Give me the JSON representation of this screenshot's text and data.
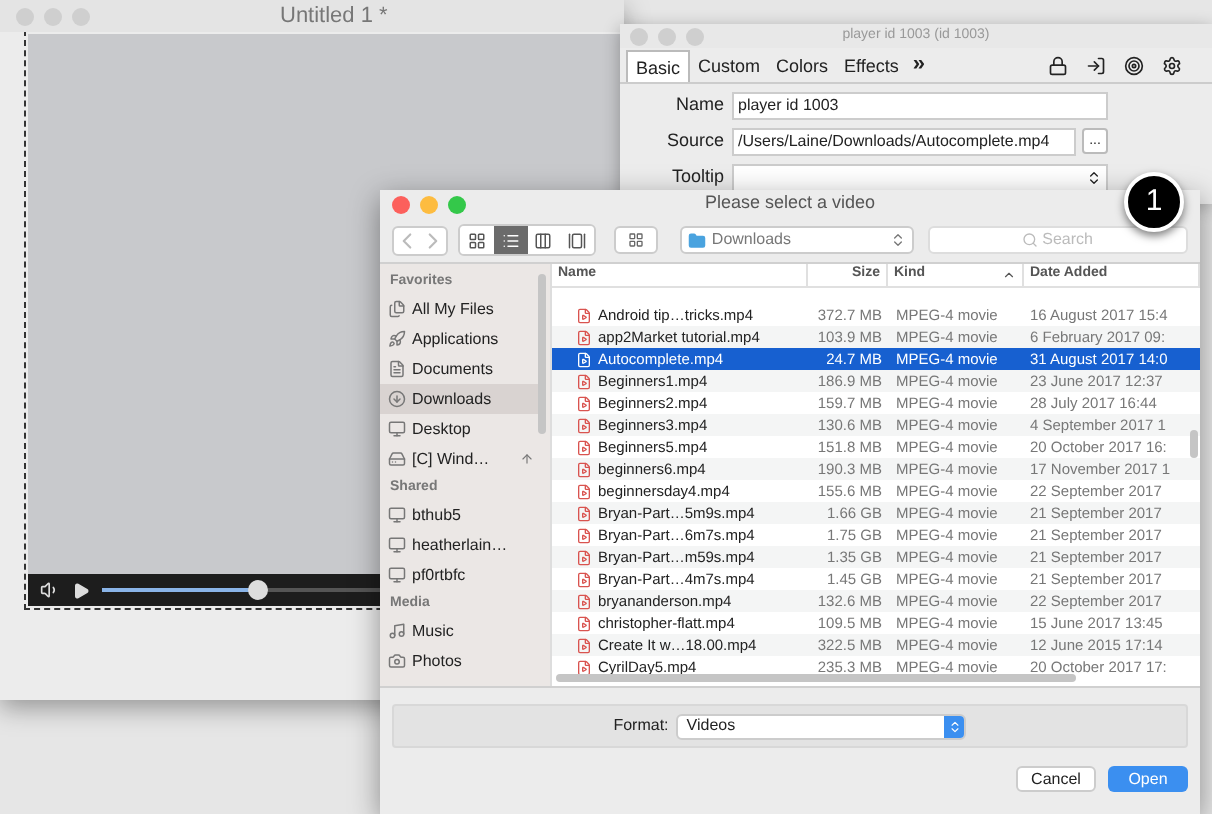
{
  "background_window": {
    "title": "Untitled 1 *",
    "player": {
      "level": 0.31
    }
  },
  "inspector": {
    "title": "player id 1003 (id 1003)",
    "tabs": [
      {
        "label": "Basic",
        "selected": true
      },
      {
        "label": "Custom",
        "selected": false
      },
      {
        "label": "Colors",
        "selected": false
      },
      {
        "label": "Effects",
        "selected": false
      }
    ],
    "more": "»",
    "fields": [
      {
        "kind": "plain",
        "label": "Name",
        "value": "player id 1003"
      },
      {
        "kind": "browse",
        "label": "Source",
        "value": "/Users/Laine/Downloads/Autocomplete.mp4",
        "button": "..."
      },
      {
        "kind": "stepper",
        "label": "Tooltip"
      }
    ]
  },
  "callout": {
    "number": "1"
  },
  "dialog": {
    "title": "Please select a video",
    "view_modes": [
      {
        "kind": "icons",
        "selected": false
      },
      {
        "kind": "list",
        "selected": true
      },
      {
        "kind": "columns",
        "selected": false
      },
      {
        "kind": "coverflow",
        "selected": false
      }
    ],
    "location": "Downloads",
    "search": {
      "placeholder": "Search"
    },
    "sidebar": [
      {
        "heading": "Favorites",
        "items": [
          {
            "kind": "files",
            "label": "All My Files",
            "selected": false
          },
          {
            "kind": "apps",
            "label": "Applications",
            "selected": false
          },
          {
            "kind": "documents",
            "label": "Documents",
            "selected": false
          },
          {
            "kind": "downloads",
            "label": "Downloads",
            "selected": true
          },
          {
            "kind": "desktop",
            "label": "Desktop",
            "selected": false
          },
          {
            "kind": "disk",
            "label": "[C] Wind…",
            "selected": false
          }
        ]
      },
      {
        "heading": "Shared",
        "items": [
          {
            "kind": "computer",
            "label": "bthub5",
            "selected": false
          },
          {
            "kind": "computer",
            "label": "heatherlain…",
            "selected": false
          },
          {
            "kind": "computer",
            "label": "pf0rtbfc",
            "selected": false
          }
        ]
      },
      {
        "heading": "Media",
        "items": [
          {
            "kind": "music",
            "label": "Music",
            "selected": false
          },
          {
            "kind": "photos",
            "label": "Photos",
            "selected": false
          }
        ]
      }
    ],
    "columns": [
      {
        "label": "Name",
        "sorted": false
      },
      {
        "label": "Size",
        "sorted": false
      },
      {
        "label": "Kind",
        "sorted": true
      },
      {
        "label": "Date Added",
        "sorted": false
      }
    ],
    "rows": [
      {
        "name": "Android tip…tricks.mp4",
        "size": "372.7 MB",
        "kind": "MPEG-4 movie",
        "date": "16 August 2017 15:4",
        "selected": false
      },
      {
        "name": "app2Market tutorial.mp4",
        "size": "103.9 MB",
        "kind": "MPEG-4 movie",
        "date": "6 February 2017 09:",
        "selected": false
      },
      {
        "name": "Autocomplete.mp4",
        "size": "24.7 MB",
        "kind": "MPEG-4 movie",
        "date": "31 August 2017 14:0",
        "selected": true
      },
      {
        "name": "Beginners1.mp4",
        "size": "186.9 MB",
        "kind": "MPEG-4 movie",
        "date": "23 June 2017 12:37",
        "selected": false
      },
      {
        "name": "Beginners2.mp4",
        "size": "159.7 MB",
        "kind": "MPEG-4 movie",
        "date": "28 July 2017 16:44",
        "selected": false
      },
      {
        "name": "Beginners3.mp4",
        "size": "130.6 MB",
        "kind": "MPEG-4 movie",
        "date": "4 September 2017 1",
        "selected": false
      },
      {
        "name": "Beginners5.mp4",
        "size": "151.8 MB",
        "kind": "MPEG-4 movie",
        "date": "20 October 2017 16:",
        "selected": false
      },
      {
        "name": "beginners6.mp4",
        "size": "190.3 MB",
        "kind": "MPEG-4 movie",
        "date": "17 November 2017 1",
        "selected": false
      },
      {
        "name": "beginnersday4.mp4",
        "size": "155.6 MB",
        "kind": "MPEG-4 movie",
        "date": "22 September 2017",
        "selected": false
      },
      {
        "name": "Bryan-Part…5m9s.mp4",
        "size": "1.66 GB",
        "kind": "MPEG-4 movie",
        "date": "21 September 2017",
        "selected": false
      },
      {
        "name": "Bryan-Part…6m7s.mp4",
        "size": "1.75 GB",
        "kind": "MPEG-4 movie",
        "date": "21 September 2017",
        "selected": false
      },
      {
        "name": "Bryan-Part…m59s.mp4",
        "size": "1.35 GB",
        "kind": "MPEG-4 movie",
        "date": "21 September 2017",
        "selected": false
      },
      {
        "name": "Bryan-Part…4m7s.mp4",
        "size": "1.45 GB",
        "kind": "MPEG-4 movie",
        "date": "21 September 2017",
        "selected": false
      },
      {
        "name": "bryananderson.mp4",
        "size": "132.6 MB",
        "kind": "MPEG-4 movie",
        "date": "22 September 2017",
        "selected": false
      },
      {
        "name": "christopher-flatt.mp4",
        "size": "109.5 MB",
        "kind": "MPEG-4 movie",
        "date": "15 June 2017 13:45",
        "selected": false
      },
      {
        "name": "Create It w…18.00.mp4",
        "size": "322.5 MB",
        "kind": "MPEG-4 movie",
        "date": "12 June 2015 17:14",
        "selected": false
      },
      {
        "name": "CyrilDay5.mp4",
        "size": "235.3 MB",
        "kind": "MPEG-4 movie",
        "date": "20 October 2017 17:",
        "selected": false
      }
    ],
    "format": {
      "label": "Format:",
      "value": "Videos"
    },
    "buttons": [
      {
        "label": "Cancel",
        "default": false
      },
      {
        "label": "Open",
        "default": true
      }
    ]
  }
}
